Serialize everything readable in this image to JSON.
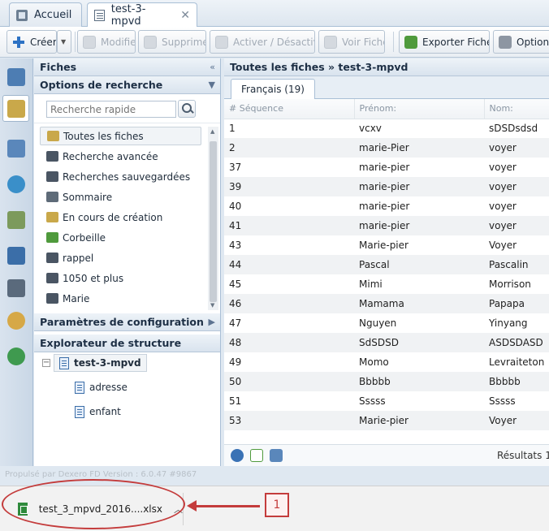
{
  "tabs": [
    {
      "label": "Accueil",
      "icon": "home-icon"
    },
    {
      "label": "test-3-mpvd",
      "icon": "edit-form-icon",
      "close": "✕"
    }
  ],
  "toolbar": {
    "create": "Créer",
    "modify": "Modifier",
    "delete": "Supprimer",
    "toggle": "Activer / Désactiver",
    "view": "Voir Fiche",
    "export": "Exporter Fiches",
    "options": "Options"
  },
  "left_panel": {
    "title": "Fiches",
    "collapse": "«",
    "search_options": "Options de recherche",
    "search_placeholder": "Recherche rapide",
    "items": [
      {
        "label": "Toutes les fiches",
        "color": "#c9a84a"
      },
      {
        "label": "Recherche avancée",
        "color": "#4a5563"
      },
      {
        "label": "Recherches sauvegardées",
        "color": "#4a5563"
      },
      {
        "label": "Sommaire",
        "color": "#5e6b78"
      },
      {
        "label": "En cours de création",
        "color": "#c9a84a"
      },
      {
        "label": "Corbeille",
        "color": "#4f9a3c"
      },
      {
        "label": "rappel",
        "color": "#4a5563"
      },
      {
        "label": "1050 et plus",
        "color": "#4a5563"
      },
      {
        "label": "Marie",
        "color": "#4a5563"
      }
    ],
    "config": "Paramètres de configuration",
    "explorer": "Explorateur de structure",
    "tree": {
      "root": "test-3-mpvd",
      "children": [
        "adresse",
        "enfant"
      ]
    }
  },
  "main": {
    "title": "Toutes les fiches » test-3-mpvd",
    "lang_tab": "Français (19)",
    "columns": [
      "# Séquence",
      "Prénom:",
      "Nom:"
    ],
    "rows": [
      [
        "1",
        "vcxv",
        "sDSDsdsd"
      ],
      [
        "2",
        "marie-Pier",
        "voyer"
      ],
      [
        "37",
        "marie-pier",
        "voyer"
      ],
      [
        "39",
        "marie-pier",
        "voyer"
      ],
      [
        "40",
        "marie-pier",
        "voyer"
      ],
      [
        "41",
        "marie-pier",
        "voyer"
      ],
      [
        "43",
        "Marie-pier",
        "Voyer"
      ],
      [
        "44",
        "Pascal",
        "Pascalin"
      ],
      [
        "45",
        "Mimi",
        "Morrison"
      ],
      [
        "46",
        "Mamama",
        "Papapa"
      ],
      [
        "47",
        "Nguyen",
        "Yinyang"
      ],
      [
        "48",
        "SdSDSD",
        "ASDSDASD"
      ],
      [
        "49",
        "Momo",
        "Levraiteton"
      ],
      [
        "50",
        "Bbbbb",
        "Bbbbb"
      ],
      [
        "51",
        "Sssss",
        "Sssss"
      ],
      [
        "53",
        "Marie-pier",
        "Voyer"
      ]
    ],
    "results_label": "Résultats 1"
  },
  "footer": {
    "powered_by": "Propulsé par Dexero FD Version : 6.0.47 #9867"
  },
  "download": {
    "filename": "test_3_mpvd_2016....xlsx",
    "callout": "1"
  },
  "colors": {
    "accent": "#2d72c4",
    "annotation": "#c43c3c"
  }
}
